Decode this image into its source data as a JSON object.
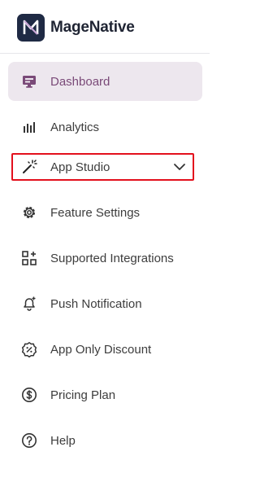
{
  "brand": {
    "name": "MageNative",
    "logo_icon": "magenative-logo"
  },
  "colors": {
    "active_bg": "#ede7ee",
    "active_text": "#7a4a78",
    "highlight_border": "#e3101d",
    "brand_dark": "#1f2a44"
  },
  "nav": {
    "items": [
      {
        "label": "Dashboard",
        "icon": "monitor-icon",
        "active": true
      },
      {
        "label": "Analytics",
        "icon": "bar-chart-icon"
      },
      {
        "label": "App Studio",
        "icon": "magic-wand-icon",
        "expandable": true,
        "highlighted": true
      },
      {
        "label": "Feature Settings",
        "icon": "gear-icon"
      },
      {
        "label": "Supported Integrations",
        "icon": "grid-plus-icon"
      },
      {
        "label": "Push Notification",
        "icon": "bell-plus-icon"
      },
      {
        "label": "App Only Discount",
        "icon": "discount-badge-icon"
      },
      {
        "label": "Pricing Plan",
        "icon": "dollar-circle-icon"
      },
      {
        "label": "Help",
        "icon": "help-circle-icon"
      }
    ]
  }
}
